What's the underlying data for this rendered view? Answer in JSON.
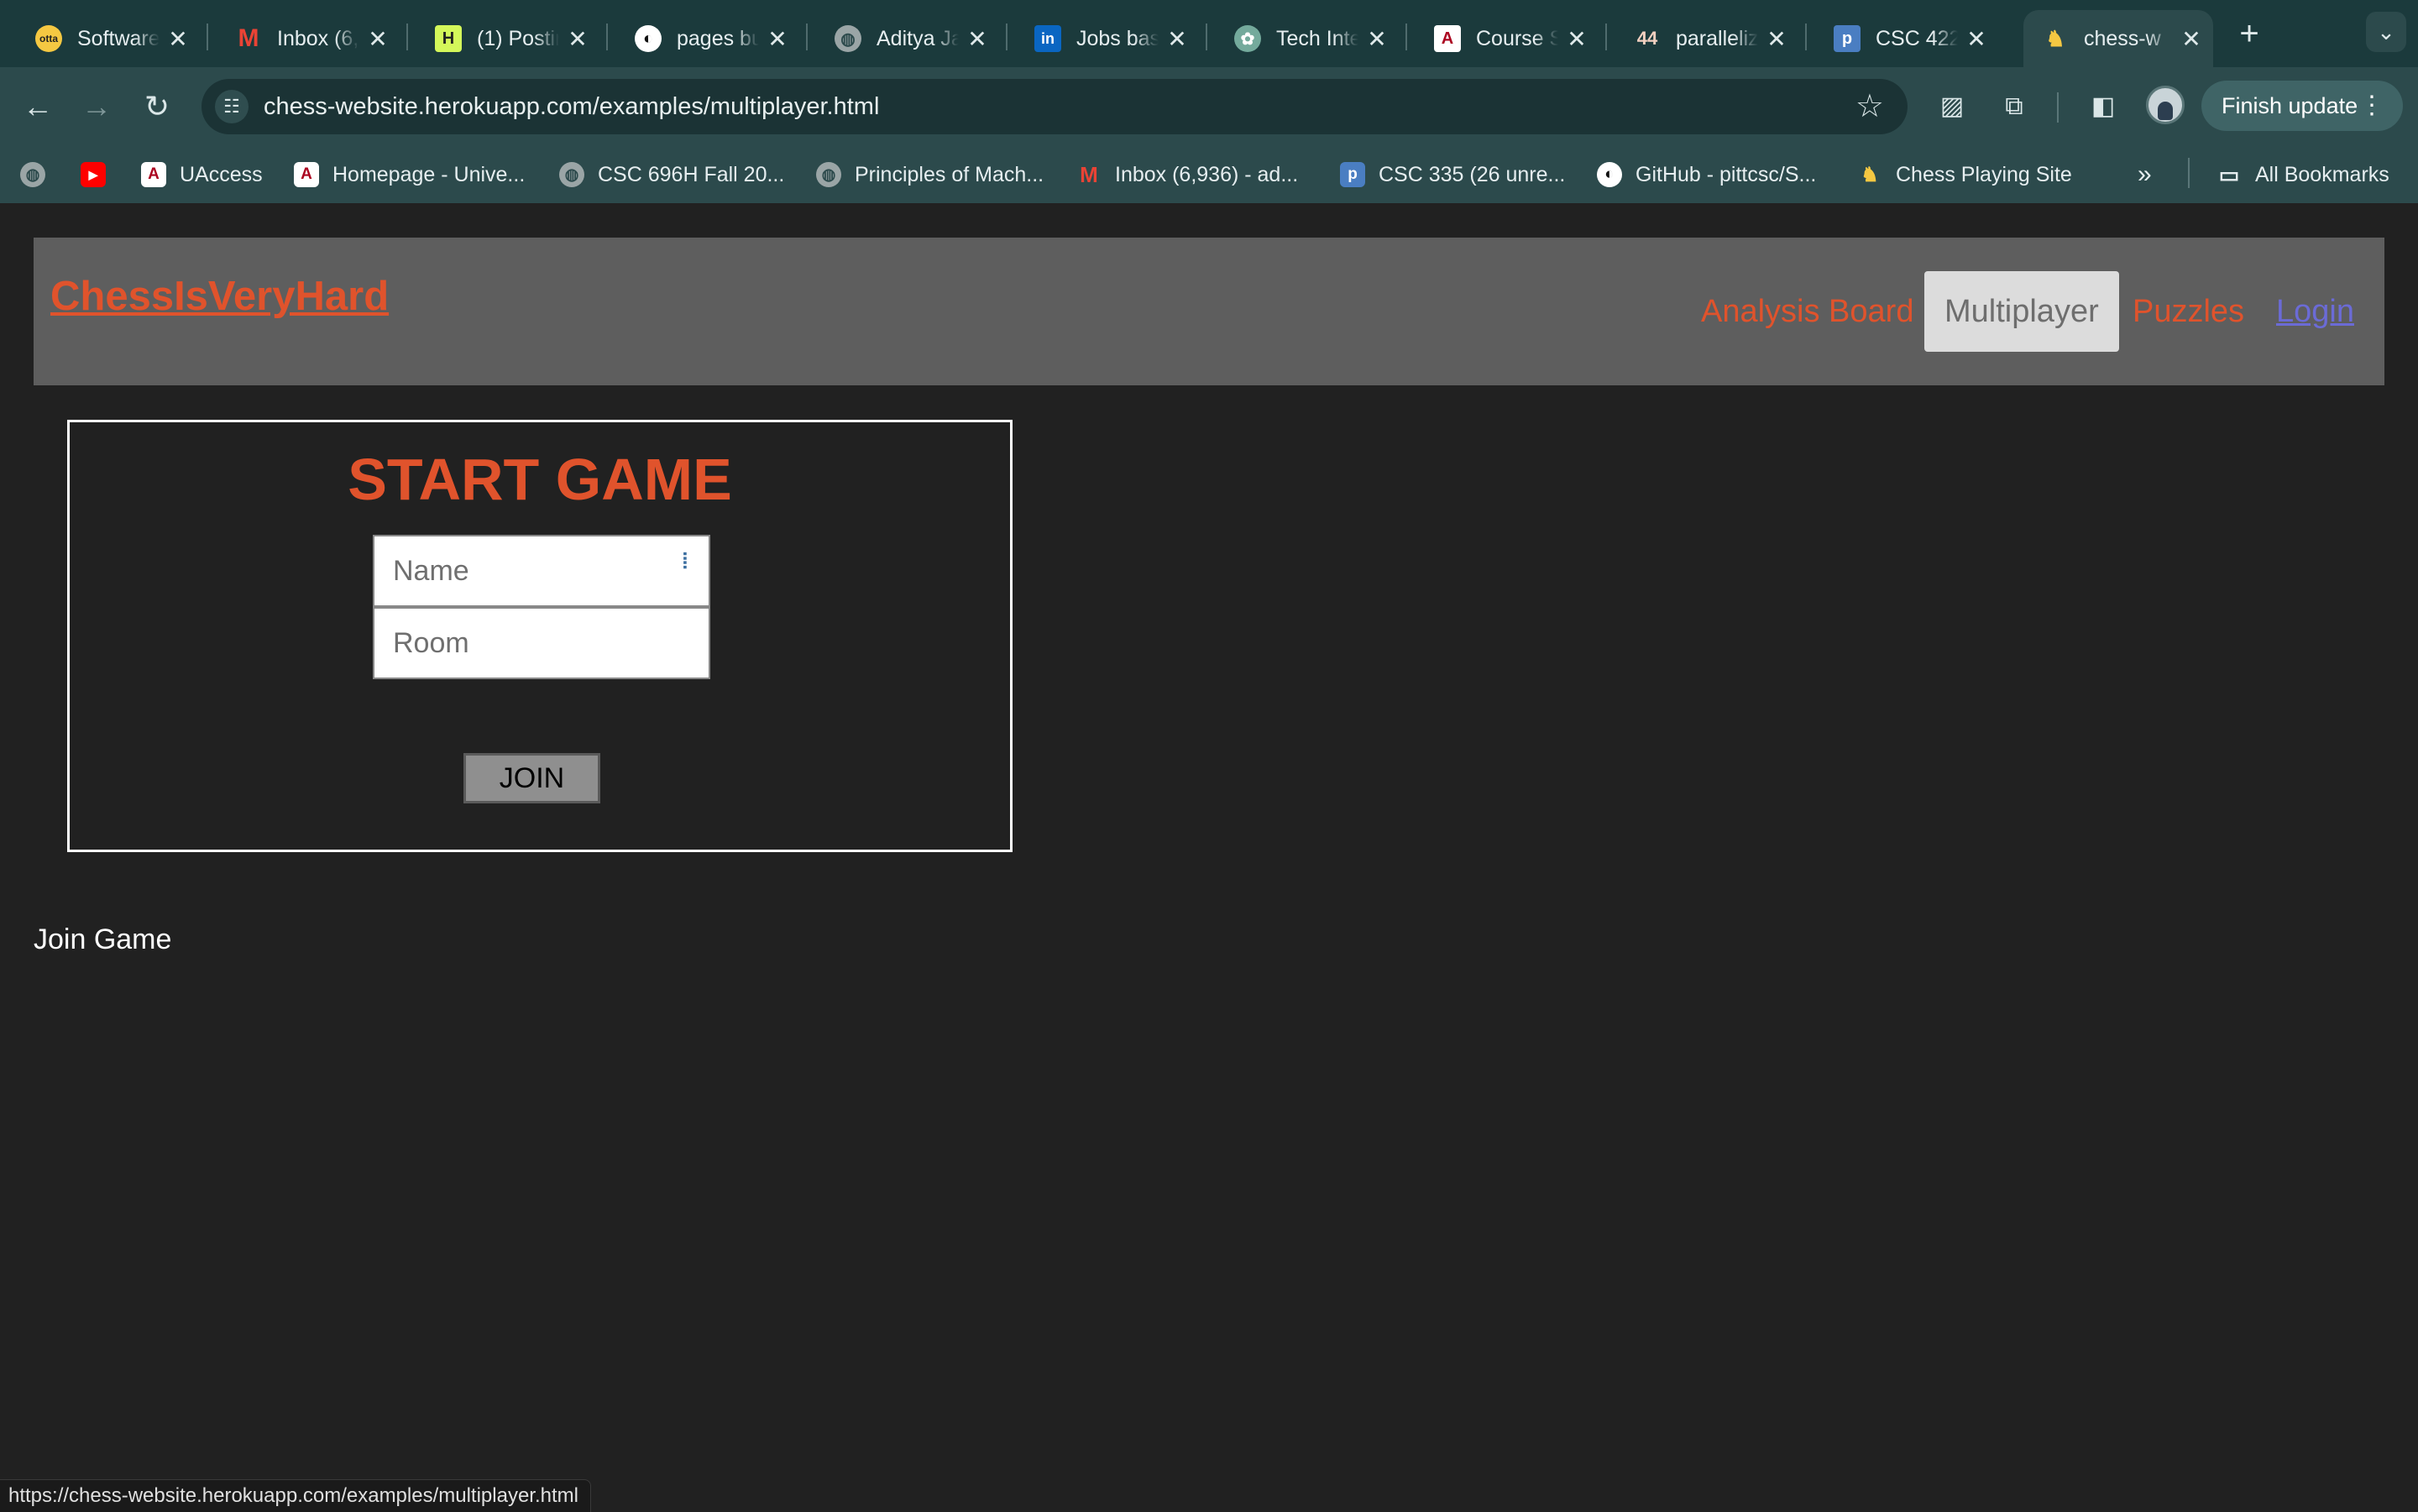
{
  "browser": {
    "tabs": [
      {
        "title": "Software",
        "icon": "otta"
      },
      {
        "title": "Inbox (6,",
        "icon": "M"
      },
      {
        "title": "(1) Postin",
        "icon": "H"
      },
      {
        "title": "pages bu",
        "icon": "G"
      },
      {
        "title": "Aditya Ja",
        "icon": "globe"
      },
      {
        "title": "Jobs bas",
        "icon": "in"
      },
      {
        "title": "Tech Inte",
        "icon": "ai"
      },
      {
        "title": "Course S",
        "icon": "A"
      },
      {
        "title": "paralleliz",
        "icon": "44"
      },
      {
        "title": "CSC 422",
        "icon": "p"
      },
      {
        "title": "chess-w",
        "icon": "chess"
      }
    ],
    "url": "chess-website.herokuapp.com/examples/multiplayer.html",
    "finish_update_label": "Finish update",
    "bookmarks": [
      {
        "label": "",
        "icon": "globe"
      },
      {
        "label": "",
        "icon": "youtube"
      },
      {
        "label": "UAccess",
        "icon": "A"
      },
      {
        "label": "Homepage - Unive...",
        "icon": "A"
      },
      {
        "label": "CSC 696H Fall 20...",
        "icon": "globe"
      },
      {
        "label": "Principles of Mach...",
        "icon": "globe"
      },
      {
        "label": "Inbox (6,936) - ad...",
        "icon": "M"
      },
      {
        "label": "CSC 335 (26 unre...",
        "icon": "p"
      },
      {
        "label": "GitHub - pittcsc/S...",
        "icon": "github"
      },
      {
        "label": "Chess Playing Site",
        "icon": "chess"
      }
    ],
    "all_bookmarks_label": "All Bookmarks",
    "status_url": "https://chess-website.herokuapp.com/examples/multiplayer.html"
  },
  "site": {
    "logo": "ChessIsVeryHard",
    "nav": {
      "analysis": "Analysis Board",
      "multiplayer": "Multiplayer",
      "puzzles": "Puzzles",
      "login": "Login"
    }
  },
  "game": {
    "title": "START GAME",
    "name_placeholder": "Name",
    "room_placeholder": "Room",
    "join_label": "JOIN"
  },
  "join_game_text": "Join Game"
}
